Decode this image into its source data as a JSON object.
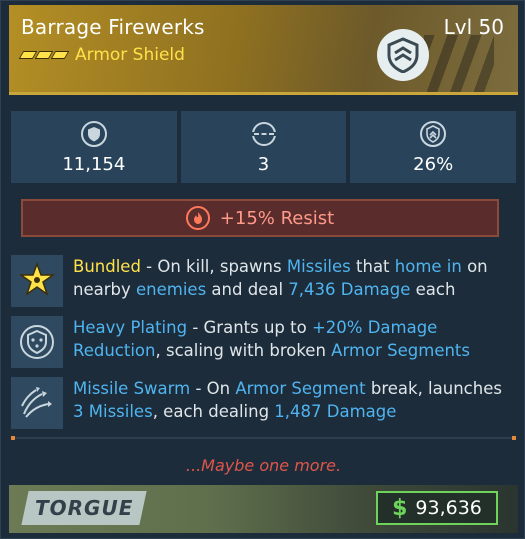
{
  "item": {
    "name": "Barrage Firewerks",
    "level": "Lvl 50",
    "type": "Armor Shield",
    "rarity_color": "#ffe14a"
  },
  "stats": [
    {
      "icon": "shield-capacity-icon",
      "value": "11,154"
    },
    {
      "icon": "armor-segments-icon",
      "value": "3"
    },
    {
      "icon": "reduction-icon",
      "value": "26%"
    }
  ],
  "element": {
    "icon": "fire-icon",
    "text": "+15% Resist",
    "color": "#ff9a8a"
  },
  "perks": [
    {
      "icon": "star-burst-icon",
      "parts": [
        {
          "t": "Bundled",
          "c": "y"
        },
        {
          "t": " - On kill, spawns ",
          "c": ""
        },
        {
          "t": "Missiles",
          "c": "b"
        },
        {
          "t": " that ",
          "c": ""
        },
        {
          "t": "home in",
          "c": "b"
        },
        {
          "t": " on nearby ",
          "c": ""
        },
        {
          "t": "enemies",
          "c": "b"
        },
        {
          "t": " and deal ",
          "c": ""
        },
        {
          "t": "7,436 Damage",
          "c": "b"
        },
        {
          "t": " each",
          "c": ""
        }
      ]
    },
    {
      "icon": "heavy-plating-icon",
      "parts": [
        {
          "t": "Heavy Plating",
          "c": "b"
        },
        {
          "t": " - Grants up to ",
          "c": ""
        },
        {
          "t": "+20% Damage Reduction",
          "c": "b"
        },
        {
          "t": ", scaling with broken ",
          "c": ""
        },
        {
          "t": "Armor Segments",
          "c": "b"
        }
      ]
    },
    {
      "icon": "missile-swarm-icon",
      "parts": [
        {
          "t": "Missile Swarm",
          "c": "b"
        },
        {
          "t": " - On ",
          "c": ""
        },
        {
          "t": "Armor Segment",
          "c": "b"
        },
        {
          "t": " break, launches ",
          "c": ""
        },
        {
          "t": "3 Missiles",
          "c": "b"
        },
        {
          "t": ", each dealing ",
          "c": ""
        },
        {
          "t": "1,487 Damage",
          "c": "b"
        }
      ]
    }
  ],
  "flavor": "...Maybe one more.",
  "manufacturer": "TORGUE",
  "price": {
    "currency": "$",
    "amount": "93,636",
    "color": "#6ed35a"
  }
}
